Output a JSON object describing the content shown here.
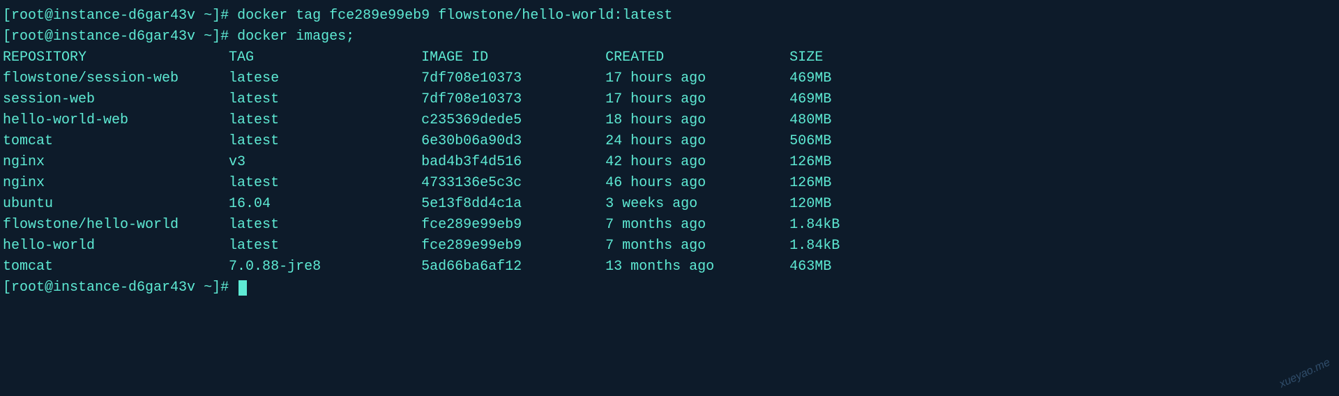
{
  "prompt": {
    "user_host": "root@instance-d6gar43v",
    "path": "~",
    "symbol": "#"
  },
  "commands": {
    "cmd1": "docker tag fce289e99eb9 flowstone/hello-world:latest",
    "cmd2": "docker images;"
  },
  "table": {
    "headers": {
      "repository": "REPOSITORY",
      "tag": "TAG",
      "image_id": "IMAGE ID",
      "created": "CREATED",
      "size": "SIZE"
    },
    "rows": [
      {
        "repository": "flowstone/session-web",
        "tag": "latese",
        "image_id": "7df708e10373",
        "created": "17 hours ago",
        "size": "469MB"
      },
      {
        "repository": "session-web",
        "tag": "latest",
        "image_id": "7df708e10373",
        "created": "17 hours ago",
        "size": "469MB"
      },
      {
        "repository": "hello-world-web",
        "tag": "latest",
        "image_id": "c235369dede5",
        "created": "18 hours ago",
        "size": "480MB"
      },
      {
        "repository": "tomcat",
        "tag": "latest",
        "image_id": "6e30b06a90d3",
        "created": "24 hours ago",
        "size": "506MB"
      },
      {
        "repository": "nginx",
        "tag": "v3",
        "image_id": "bad4b3f4d516",
        "created": "42 hours ago",
        "size": "126MB"
      },
      {
        "repository": "nginx",
        "tag": "latest",
        "image_id": "4733136e5c3c",
        "created": "46 hours ago",
        "size": "126MB"
      },
      {
        "repository": "ubuntu",
        "tag": "16.04",
        "image_id": "5e13f8dd4c1a",
        "created": "3 weeks ago",
        "size": "120MB"
      },
      {
        "repository": "flowstone/hello-world",
        "tag": "latest",
        "image_id": "fce289e99eb9",
        "created": "7 months ago",
        "size": "1.84kB"
      },
      {
        "repository": "hello-world",
        "tag": "latest",
        "image_id": "fce289e99eb9",
        "created": "7 months ago",
        "size": "1.84kB"
      },
      {
        "repository": "tomcat",
        "tag": "7.0.88-jre8",
        "image_id": "5ad66ba6af12",
        "created": "13 months ago",
        "size": "463MB"
      }
    ]
  },
  "watermark": "xueyao.me"
}
